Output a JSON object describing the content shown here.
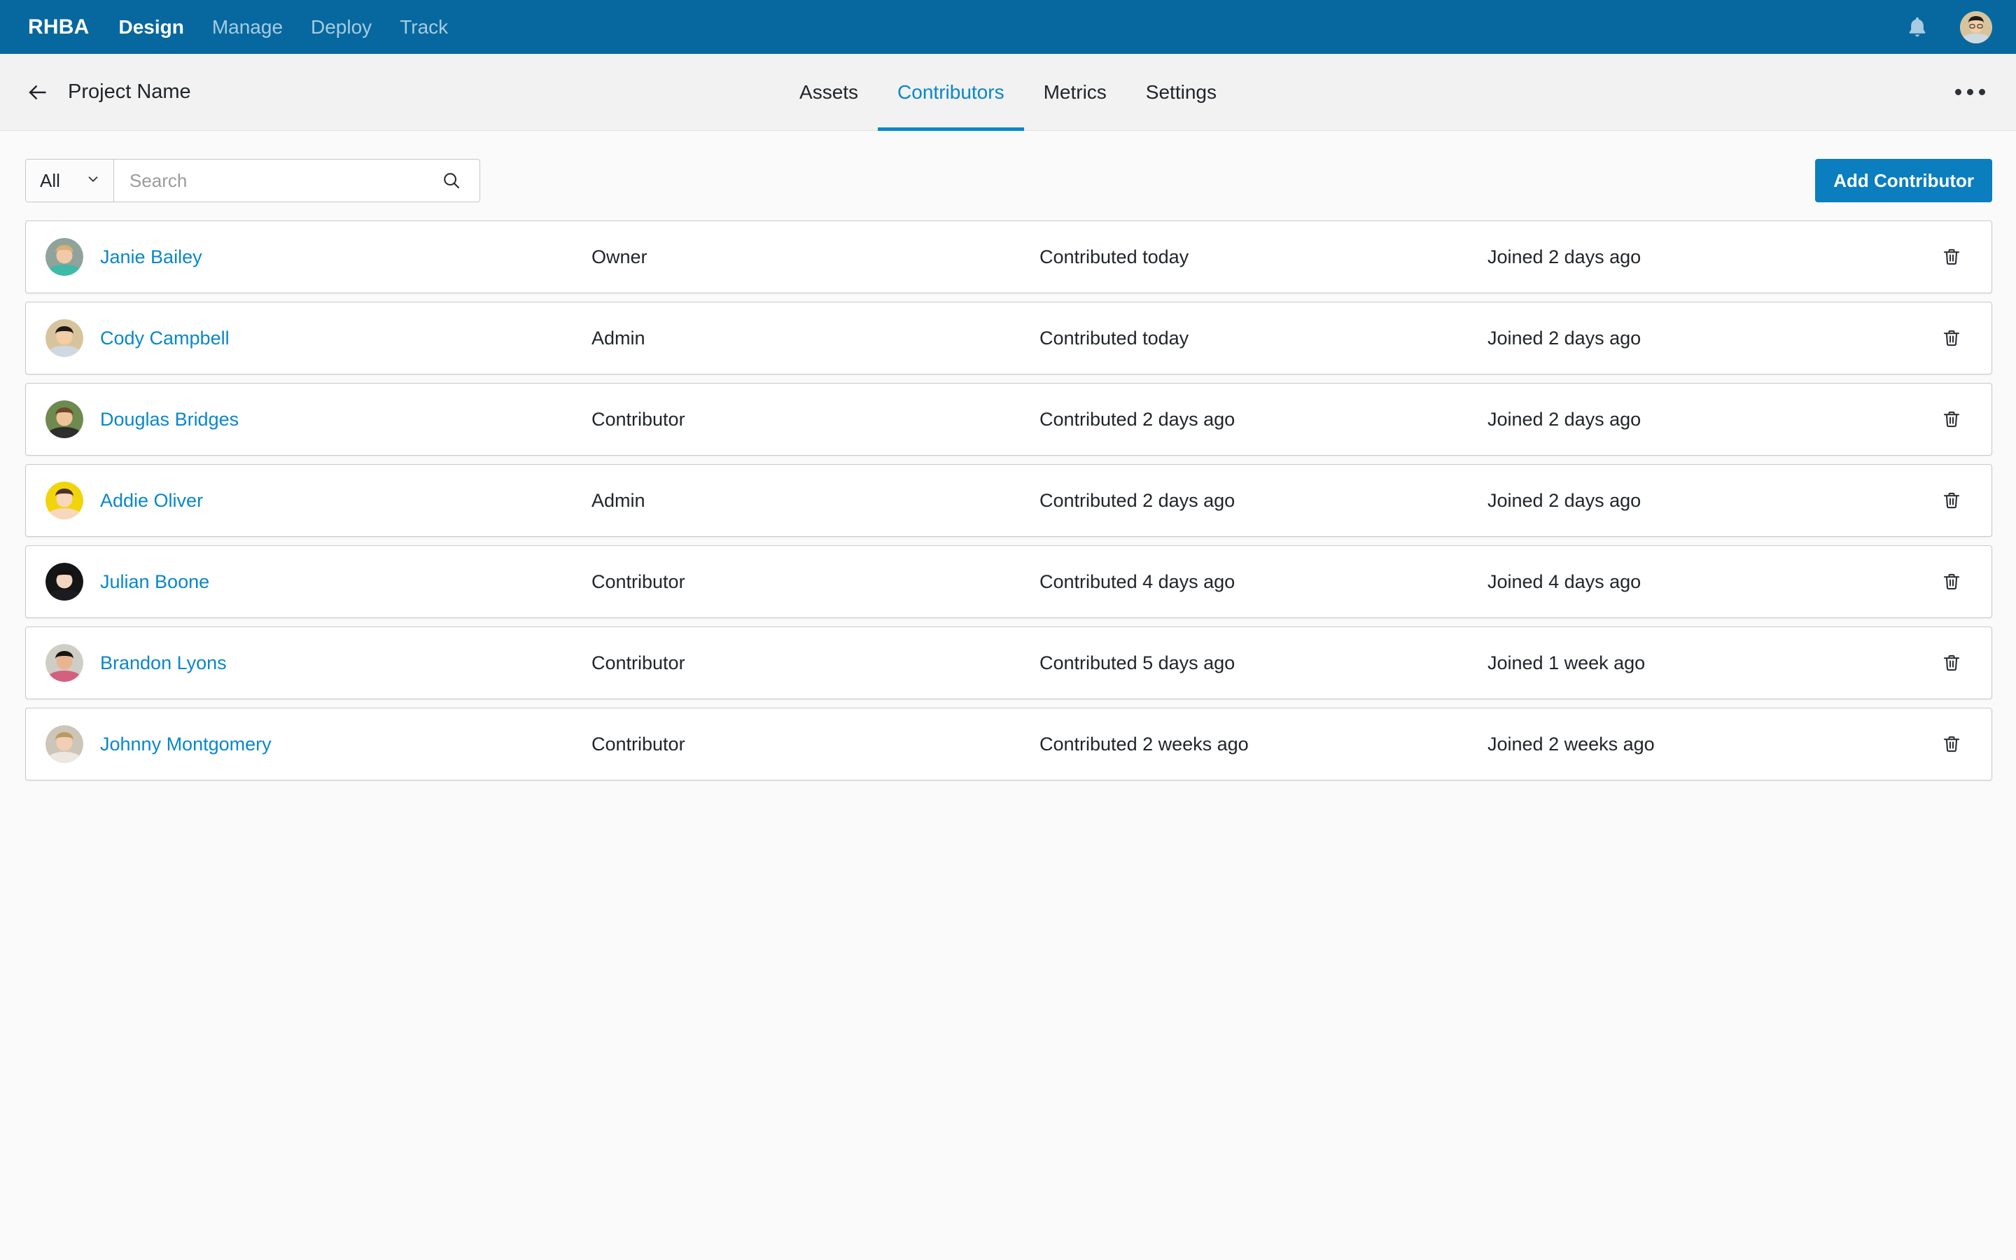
{
  "topnav": {
    "brand": "RHBA",
    "links": [
      {
        "label": "Design",
        "active": true
      },
      {
        "label": "Manage",
        "active": false
      },
      {
        "label": "Deploy",
        "active": false
      },
      {
        "label": "Track",
        "active": false
      }
    ],
    "notifications_icon": "bell-icon",
    "avatar_icon": "user-avatar"
  },
  "subheader": {
    "back_icon": "arrow-left-icon",
    "title": "Project Name",
    "overflow_icon": "ellipsis-icon",
    "tabs": [
      {
        "label": "Assets",
        "active": false
      },
      {
        "label": "Contributors",
        "active": true
      },
      {
        "label": "Metrics",
        "active": false
      },
      {
        "label": "Settings",
        "active": false
      }
    ]
  },
  "toolbar": {
    "filter_value": "All",
    "filter_chevron_icon": "chevron-down-icon",
    "search_value": "",
    "search_placeholder": "Search",
    "search_icon": "search-icon",
    "add_label": "Add Contributor"
  },
  "table": {
    "delete_icon": "trash-icon",
    "rows": [
      {
        "name": "Janie Bailey",
        "role": "Owner",
        "contributed": "Contributed today",
        "joined": "Joined 2 days ago",
        "avatar": {
          "bg": "#8fa39b",
          "skin": "#f0c9a8",
          "hair": "#d9b072",
          "shirt": "#3fb9a8"
        }
      },
      {
        "name": "Cody Campbell",
        "role": "Admin",
        "contributed": "Contributed today",
        "joined": "Joined 2 days ago",
        "avatar": {
          "bg": "#d8c49c",
          "skin": "#f2cda6",
          "hair": "#1d1b19",
          "shirt": "#cfd8e0"
        }
      },
      {
        "name": "Douglas Bridges",
        "role": "Contributor",
        "contributed": "Contributed 2 days ago",
        "joined": "Joined 2 days ago",
        "avatar": {
          "bg": "#6e8a4e",
          "skin": "#f0c49a",
          "hair": "#6b4a2c",
          "shirt": "#2e2e2e"
        }
      },
      {
        "name": "Addie Oliver",
        "role": "Admin",
        "contributed": "Contributed 2 days ago",
        "joined": "Joined 2 days ago",
        "avatar": {
          "bg": "#f2d40c",
          "skin": "#f7d7bd",
          "hair": "#4a3326",
          "shirt": "#f7d7bd"
        }
      },
      {
        "name": "Julian Boone",
        "role": "Contributor",
        "contributed": "Contributed 4 days ago",
        "joined": "Joined 4 days ago",
        "avatar": {
          "bg": "#151515",
          "skin": "#f3d6c2",
          "hair": "#14100f",
          "shirt": "#1b1b22"
        }
      },
      {
        "name": "Brandon Lyons",
        "role": "Contributor",
        "contributed": "Contributed 5 days ago",
        "joined": "Joined 1 week ago",
        "avatar": {
          "bg": "#cfcec6",
          "skin": "#e8b590",
          "hair": "#171513",
          "shirt": "#d4607f"
        }
      },
      {
        "name": "Johnny Montgomery",
        "role": "Contributor",
        "contributed": "Contributed 2 weeks ago",
        "joined": "Joined 2 weeks ago",
        "avatar": {
          "bg": "#cdc6b8",
          "skin": "#f2cfb4",
          "hair": "#b99a63",
          "shirt": "#ece7e1"
        }
      }
    ]
  },
  "colors": {
    "nav_blue": "#06689f",
    "accent_blue": "#0887ca",
    "button_blue": "#0a7ebe",
    "page_bg": "#fafafa",
    "text": "#21252a"
  }
}
